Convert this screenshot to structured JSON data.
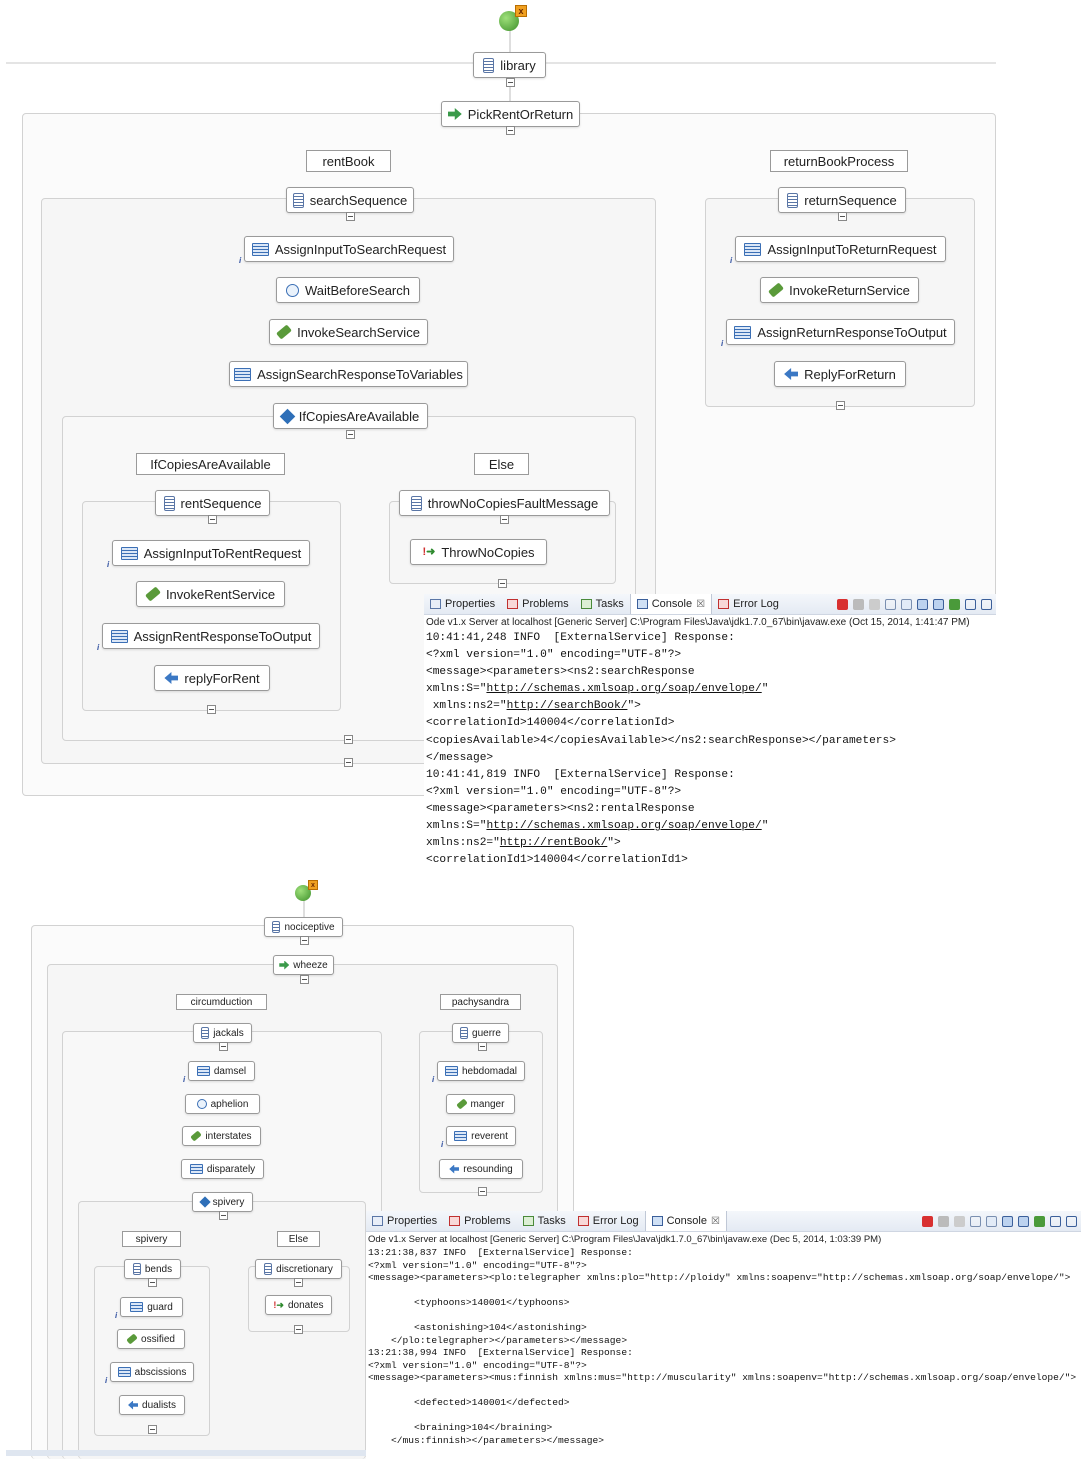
{
  "diagram1": {
    "process": "library",
    "pick": "PickRentOrReturn",
    "branches": [
      "rentBook",
      "returnBookProcess"
    ],
    "rent": {
      "sequence": "searchSequence",
      "activities": [
        "AssignInputToSearchRequest",
        "WaitBeforeSearch",
        "InvokeSearchService",
        "AssignSearchResponseToVariables"
      ],
      "if": "IfCopiesAreAvailable",
      "if_branches": [
        "IfCopiesAreAvailable",
        "Else"
      ],
      "then_sequence": "rentSequence",
      "then_activities": [
        "AssignInputToRentRequest",
        "InvokeRentService",
        "AssignRentResponseToOutput",
        "replyForRent"
      ],
      "else_sequence": "throwNoCopiesFaultMessage",
      "else_activity": "ThrowNoCopies"
    },
    "return": {
      "sequence": "returnSequence",
      "activities": [
        "AssignInputToReturnRequest",
        "InvokeReturnService",
        "AssignReturnResponseToOutput",
        "ReplyForReturn"
      ]
    }
  },
  "console1": {
    "tabs": [
      "Properties",
      "Problems",
      "Tasks",
      "Console",
      "Error Log"
    ],
    "server_line": "Ode v1.x Server at localhost [Generic Server] C:\\Program Files\\Java\\jdk1.7.0_67\\bin\\javaw.exe (Oct 15, 2014, 1:41:47 PM)",
    "lines": [
      "10:41:41,248 INFO  [ExternalService] Response:",
      "<?xml version=\"1.0\" encoding=\"UTF-8\"?>",
      "<message><parameters><ns2:searchResponse",
      "xmlns:S=\"|http://schemas.xmlsoap.org/soap/envelope/|\"",
      " xmlns:ns2=\"|http://searchBook/|\">",
      "<correlationId>140004</correlationId>",
      "<copiesAvailable>4</copiesAvailable></ns2:searchResponse></parameters>",
      "</message>",
      "10:41:41,819 INFO  [ExternalService] Response:",
      "<?xml version=\"1.0\" encoding=\"UTF-8\"?>",
      "<message><parameters><ns2:rentalResponse",
      "xmlns:S=\"|http://schemas.xmlsoap.org/soap/envelope/|\"",
      "xmlns:ns2=\"|http://rentBook/|\">",
      "<correlationId1>140004</correlationId1>"
    ]
  },
  "diagram2": {
    "process": "nociceptive",
    "pick": "wheeze",
    "branches": [
      "circumduction",
      "pachysandra"
    ],
    "left": {
      "sequence": "jackals",
      "activities": [
        "damsel",
        "aphelion",
        "interstates",
        "disparately"
      ],
      "if": "spivery",
      "if_branches": [
        "spivery",
        "Else"
      ],
      "then_sequence": "bends",
      "then_activities": [
        "guard",
        "ossified",
        "abscissions",
        "dualists"
      ],
      "else_sequence": "discretionary",
      "else_activity": "donates"
    },
    "right": {
      "sequence": "guerre",
      "activities": [
        "hebdomadal",
        "manger",
        "reverent",
        "resounding"
      ]
    }
  },
  "console2": {
    "tabs": [
      "Properties",
      "Problems",
      "Tasks",
      "Error Log",
      "Console"
    ],
    "server_line": "Ode v1.x Server at localhost [Generic Server] C:\\Program Files\\Java\\jdk1.7.0_67\\bin\\javaw.exe (Dec 5, 2014, 1:03:39 PM)",
    "lines": [
      "13:21:38,837 INFO  [ExternalService] Response:",
      "<?xml version=\"1.0\" encoding=\"UTF-8\"?>",
      "<message><parameters><plo:telegrapher xmlns:plo=\"http://ploidy\" xmlns:soapenv=\"http://schemas.xmlsoap.org/soap/envelope/\">",
      "",
      "        <typhoons>140001</typhoons>",
      "",
      "        <astonishing>104</astonishing>",
      "    </plo:telegrapher></parameters></message>",
      "13:21:38,994 INFO  [ExternalService] Response:",
      "<?xml version=\"1.0\" encoding=\"UTF-8\"?>",
      "<message><parameters><mus:finnish xmlns:mus=\"http://muscularity\" xmlns:soapenv=\"http://schemas.xmlsoap.org/soap/envelope/\">",
      "",
      "        <defected>140001</defected>",
      "",
      "        <braining>104</braining>",
      "    </mus:finnish></parameters></message>"
    ]
  }
}
